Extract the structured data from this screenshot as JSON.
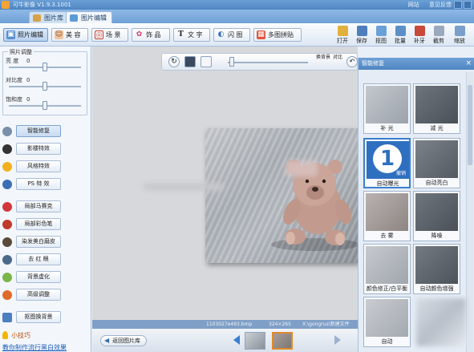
{
  "app": {
    "title": "可牛影像 V1.9.3.1001",
    "links": [
      "网站",
      "意见反馈"
    ]
  },
  "tabs": [
    {
      "label": "图片库",
      "active": false
    },
    {
      "label": "图片编辑",
      "active": true
    }
  ],
  "toolbar": {
    "buttons": [
      {
        "label": "照片编辑",
        "icon": "photo-edit-icon",
        "active": true
      },
      {
        "label": "美 容",
        "icon": "face-icon",
        "active": false
      },
      {
        "label": "场 景",
        "icon": "scene-icon",
        "active": false
      },
      {
        "label": "饰 品",
        "icon": "bow-icon",
        "active": false
      },
      {
        "label": "文 字",
        "icon": "text-icon",
        "active": false
      },
      {
        "label": "闪 图",
        "icon": "flash-icon",
        "active": false
      },
      {
        "label": "多图拼贴",
        "icon": "collage-icon",
        "active": false
      }
    ],
    "right_tools": [
      "打开",
      "保存",
      "抠图",
      "批量",
      "补牙",
      "截剪",
      "缩放"
    ]
  },
  "adjust": {
    "title": "照片调整",
    "sliders": [
      {
        "label": "亮 度",
        "value": "0",
        "fraction": 0.5
      },
      {
        "label": "对比度",
        "value": "0",
        "fraction": 0.5
      },
      {
        "label": "饱和度",
        "value": "0",
        "fraction": 0.5
      }
    ]
  },
  "features": [
    {
      "label": "智能修复",
      "icon": "smart-repair-icon",
      "active": true,
      "color": "#7a8fa8"
    },
    {
      "label": "影楼特效",
      "icon": "film-icon",
      "active": false,
      "color": "#333333"
    },
    {
      "label": "风格特效",
      "icon": "sun-icon",
      "active": false,
      "color": "#f2b01e"
    },
    {
      "label": "PS 特 效",
      "icon": "brush-icon",
      "active": false,
      "color": "#3a6fb5"
    },
    {
      "label": "局部马赛克",
      "icon": "heart-icon",
      "active": false,
      "color": "#d2363a"
    },
    {
      "label": "局部彩色笔",
      "icon": "heart-icon",
      "active": false,
      "color": "#c0392b"
    },
    {
      "label": "染发美白磨皮",
      "icon": "person-icon",
      "active": false,
      "color": "#5a4a3a"
    },
    {
      "label": "去 红 眼",
      "icon": "eye-icon",
      "active": false,
      "color": "#4a6a8a"
    },
    {
      "label": "背景虚化",
      "icon": "blur-icon",
      "active": false,
      "color": "#7ab648"
    },
    {
      "label": "高级调整",
      "icon": "palette-icon",
      "active": false,
      "color": "#e06a2a"
    },
    {
      "label": "抠图换背景",
      "icon": "cutout-icon",
      "active": false,
      "color": "#4b7fc1"
    }
  ],
  "tips": {
    "title": "小技巧",
    "link": "教你制作流行黑白效果"
  },
  "canvas_tools": {
    "buttons": [
      "换背景",
      "对比"
    ]
  },
  "infobar": {
    "filename": "1103027e493.bmp",
    "dimensions": "324×265",
    "path": "X:\\gongrus\\新建文件"
  },
  "filmstrip": {
    "back_label": "返回图片库"
  },
  "smart_panel": {
    "title": "智能修复",
    "close": "×",
    "undo": "撤销",
    "presets": [
      {
        "label": "补 光",
        "tone": "bright"
      },
      {
        "label": "减 光",
        "tone": "dark"
      },
      {
        "label": "自动曝光",
        "tone": "blue",
        "selected": true
      },
      {
        "label": "自动亮白",
        "tone": "dark"
      },
      {
        "label": "去 雾",
        "tone": "warm"
      },
      {
        "label": "降噪",
        "tone": "dark"
      },
      {
        "label": "颜色修正/白平衡",
        "tone": "bright"
      },
      {
        "label": "自动颜色增强",
        "tone": "dark"
      },
      {
        "label": "自动",
        "tone": "bright"
      }
    ]
  }
}
